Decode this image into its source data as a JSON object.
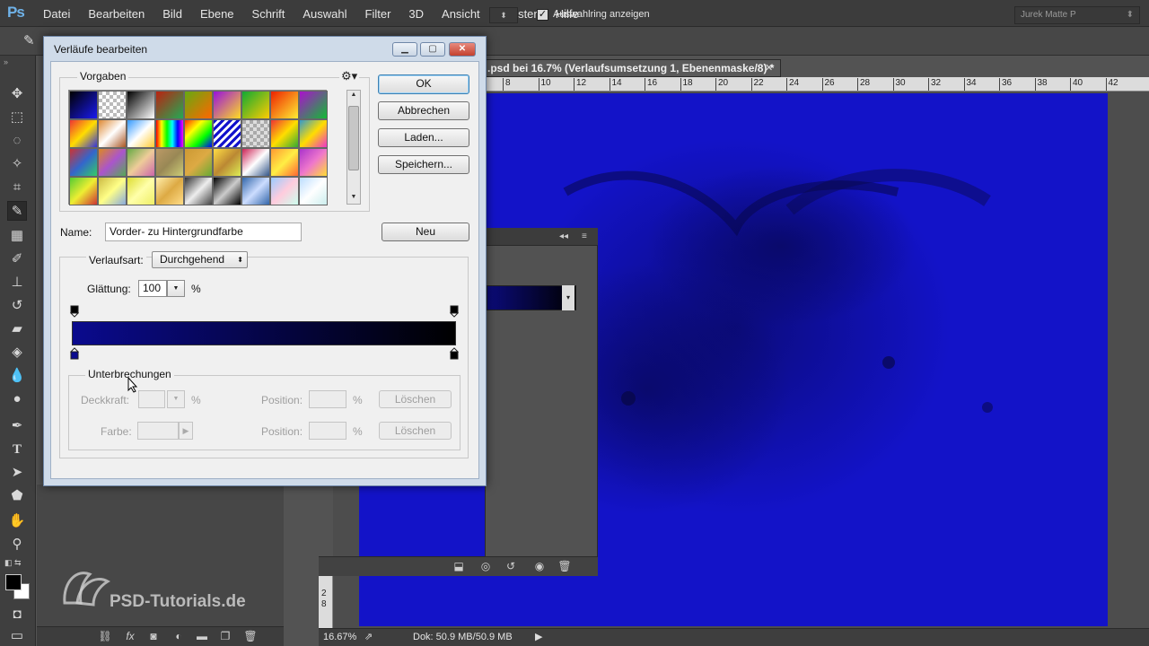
{
  "app": {
    "logo": "Ps",
    "menu": [
      "Datei",
      "Bearbeiten",
      "Bild",
      "Ebene",
      "Schrift",
      "Auswahl",
      "Filter",
      "3D",
      "Ansicht",
      "Fenster",
      "Hilfe"
    ],
    "window_controls": [
      "minimize-icon",
      "maximize-icon",
      "close-icon"
    ]
  },
  "options_bar": {
    "show_ring_label": "Auswahlring anzeigen",
    "show_ring_checked": true,
    "workspace": "Jurek Matte P"
  },
  "document": {
    "tab_title": ".psd bei 16.7% (Verlaufsumsetzung 1, Ebenenmaske/8) *",
    "ruler_ticks": [
      "8",
      "10",
      "12",
      "14",
      "16",
      "18",
      "20",
      "22",
      "24",
      "26",
      "28",
      "30",
      "32",
      "34",
      "36",
      "38",
      "40",
      "42"
    ],
    "ruler_left_ticks": [
      "2",
      "8"
    ],
    "zoom": "16.67%",
    "doc_size": "Dok: 50.9 MB/50.9 MB",
    "canvas_color": "#1313c8"
  },
  "watermark": "PSD-Tutorials.de",
  "dialog": {
    "title": "Verläufe bearbeiten",
    "presets_label": "Vorgaben",
    "buttons": {
      "ok": "OK",
      "cancel": "Abbrechen",
      "load": "Laden...",
      "save": "Speichern...",
      "new": "Neu"
    },
    "name_label": "Name:",
    "name_value": "Vorder- zu Hintergrundfarbe",
    "type_label": "Verlaufsart:",
    "type_value": "Durchgehend",
    "smoothness_label": "Glättung:",
    "smoothness_value": "100",
    "percent": "%",
    "gradient": {
      "start_color": "#0a0a8e",
      "end_color": "#000000"
    },
    "stops": {
      "label": "Unterbrechungen",
      "opacity_label": "Deckkraft:",
      "color_label": "Farbe:",
      "position_label": "Position:",
      "delete_label": "Löschen"
    }
  },
  "presets": [
    "linear-gradient(135deg,#000,#1a1af0)",
    "repeating-conic-gradient(#fff 0 25%,#bbb 0 50%) 0 0/8px 8px",
    "linear-gradient(135deg,#000,#fff)",
    "linear-gradient(135deg,#b21,#2a5)",
    "linear-gradient(135deg,#6a1,#f60)",
    "linear-gradient(135deg,#91d,#fd2)",
    "linear-gradient(135deg,#1a3,#fc0)",
    "linear-gradient(135deg,#e20,#fe3)",
    "linear-gradient(135deg,#a1c,#1b3)",
    "linear-gradient(135deg,#e33,#fd0,#33d)",
    "linear-gradient(135deg,#d83,#fff,#a52)",
    "linear-gradient(135deg,#39f,#fff,#fc3)",
    "linear-gradient(90deg,#f00,#ff0,#0f0,#0ff,#00f,#f0f)",
    "linear-gradient(135deg,#f30,#ff0,#0f0,#00f)",
    "repeating-linear-gradient(135deg,#11c 0 3px,#fff 3px 6px)",
    "repeating-conic-gradient(#ddd 0 25%,#aaa 0 50%) 0 0/8px 8px",
    "linear-gradient(135deg,#e33,#fd0,#3a3)",
    "linear-gradient(135deg,#39c,#fd0,#e3c)",
    "linear-gradient(135deg,#c33,#36c,#3c6)",
    "linear-gradient(135deg,#d82,#a5c,#5a5)",
    "linear-gradient(135deg,#6a4,#ec9,#c6a)",
    "linear-gradient(135deg,#b96,#985,#cc7)",
    "linear-gradient(135deg,#c93,#da4,#6a3)",
    "linear-gradient(135deg,#fd4,#b83,#de5)",
    "linear-gradient(135deg,#c25,#fff,#358)",
    "linear-gradient(135deg,#f93,#fe4,#f63)",
    "linear-gradient(135deg,#a3c,#e7c,#fd3)",
    "linear-gradient(135deg,#5c3,#ee3,#c33)",
    "linear-gradient(135deg,#cb4,#ff8,#8ad)",
    "linear-gradient(135deg,#dd3,#ffa,#ee6)",
    "linear-gradient(135deg,#fea,#da4,#fd8)",
    "linear-gradient(135deg,#333,#eee,#444)",
    "linear-gradient(135deg,#000,#ccc,#000)",
    "linear-gradient(135deg,#36a,#cdf,#36a)",
    "linear-gradient(135deg,#9cf,#fcd,#cfe)",
    "linear-gradient(135deg,#bdf,#fff,#cee)"
  ]
}
